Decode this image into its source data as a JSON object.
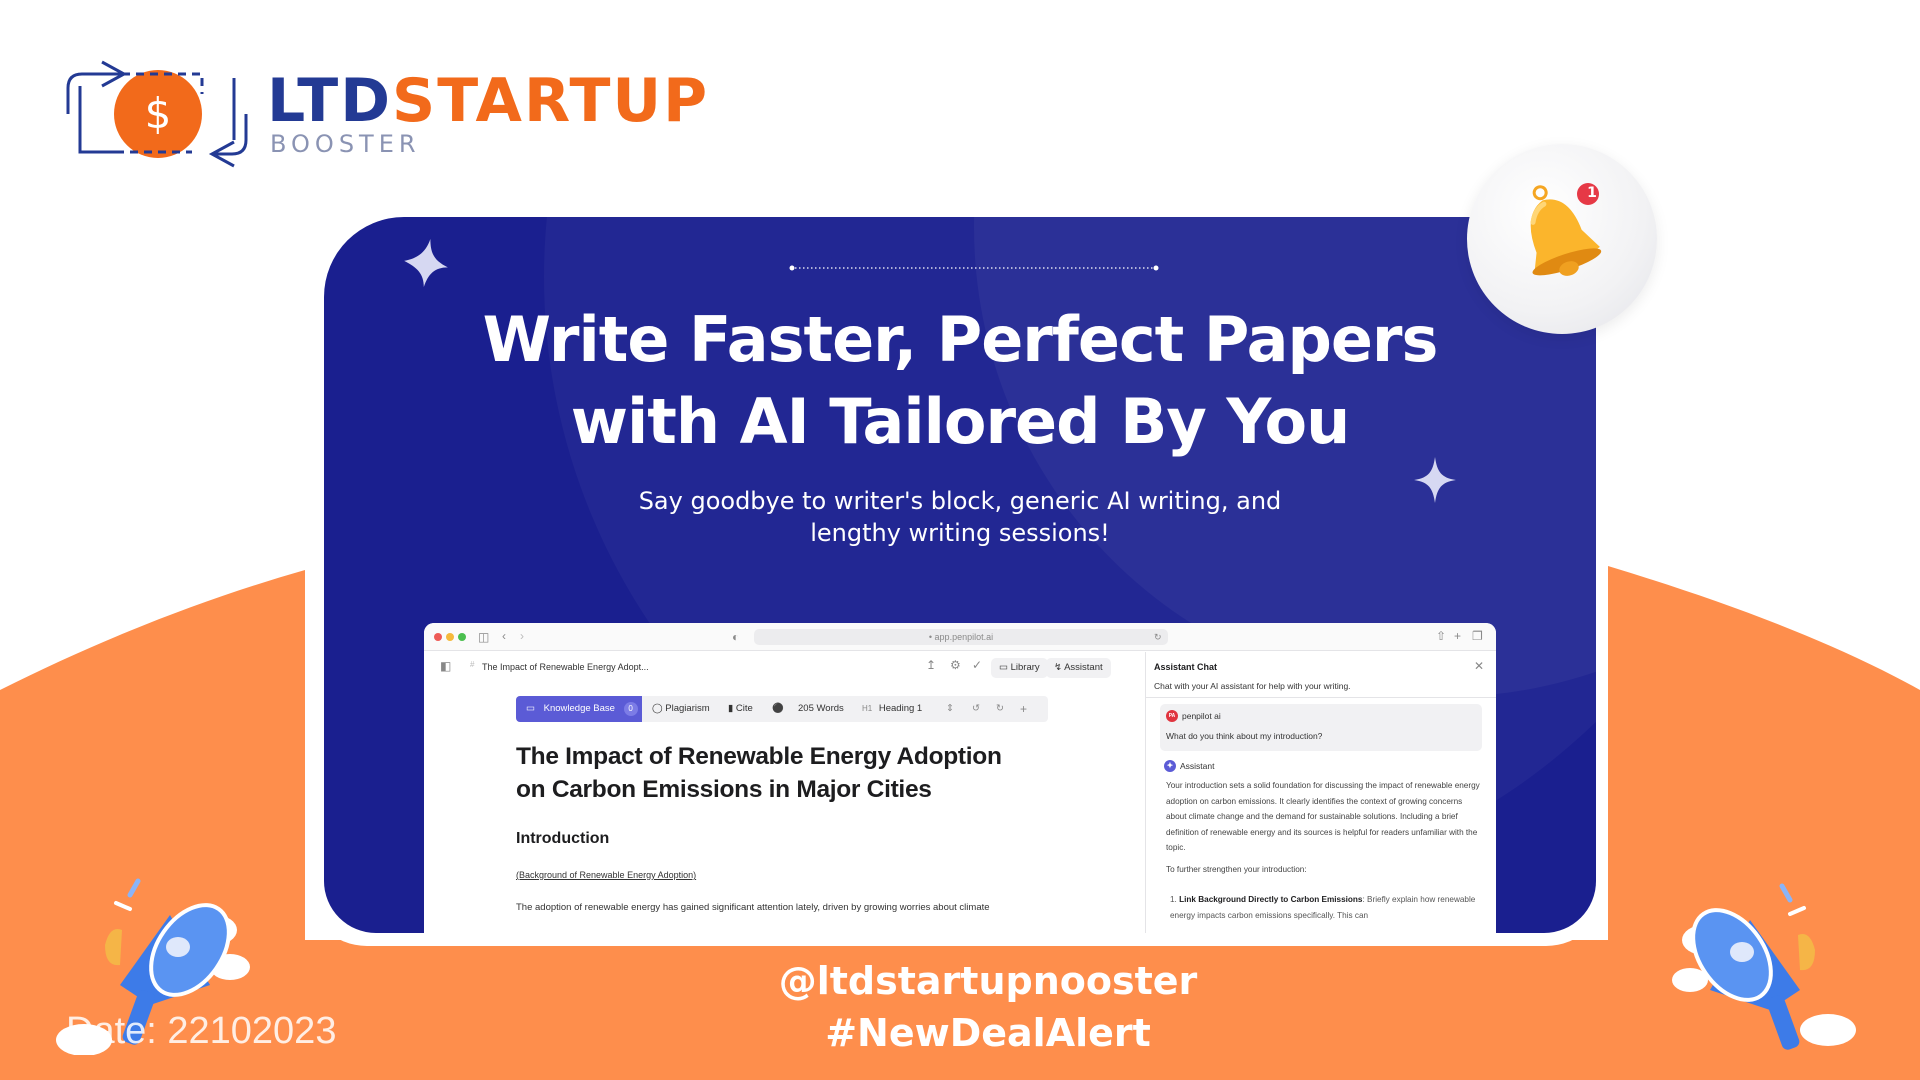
{
  "brand": {
    "name_part1": "LTD",
    "name_part2": "STARTUP",
    "tagline": "BOOSTER",
    "logo_icon": "dollar-exchange-icon",
    "colors": {
      "navy": "#233a94",
      "orange": "#f26a1b",
      "accent_orange_bg": "#fe8e4c",
      "card_blue": "#1a1f8f"
    }
  },
  "hero": {
    "headline_line1": "Write Faster, Perfect Papers",
    "headline_line2": "with AI Tailored By You",
    "subheadline": "Say goodbye to writer's block, generic AI writing, and lengthy writing sessions!"
  },
  "browser": {
    "url": "app.penpilot.ai",
    "nav_icons": [
      "sidebar-toggle-icon",
      "back-icon",
      "forward-icon",
      "shield-icon",
      "reload-icon",
      "share-icon",
      "new-tab-icon",
      "tabs-icon"
    ]
  },
  "editor": {
    "doc_breadcrumb": "The Impact of Renewable Energy Adopt...",
    "header_actions": {
      "library": "Library",
      "assistant": "Assistant"
    },
    "toolbar": {
      "knowledge_base": "Knowledge Base",
      "knowledge_base_count": "0",
      "plagiarism": "Plagiarism",
      "cite": "Cite",
      "word_count": "205 Words",
      "heading_tag": "H1",
      "heading_style": "Heading 1"
    },
    "document": {
      "title": "The Impact of Renewable Energy Adoption on Carbon Emissions in Major Cities",
      "section_heading": "Introduction",
      "section_link": "(Background of Renewable Energy Adoption)",
      "paragraph": "The adoption of renewable energy has gained significant attention lately, driven by growing worries about climate"
    }
  },
  "assistant_panel": {
    "title": "Assistant Chat",
    "subtitle": "Chat with your AI assistant for help with your writing.",
    "user_name": "penpilot ai",
    "user_avatar": "PA",
    "user_message": "What do you think about my introduction?",
    "assistant_name": "Assistant",
    "reply_paragraph": "Your introduction sets a solid foundation for discussing the impact of renewable energy adoption on carbon emissions. It clearly identifies the context of growing concerns about climate change and the demand for sustainable solutions. Including a brief definition of renewable energy and its sources is helpful for readers unfamiliar with the topic.",
    "reply_intro": "To further strengthen your introduction:",
    "reply_item_number": "1.",
    "reply_item_bold": "Link Background Directly to Carbon Emissions",
    "reply_item_text": ": Briefly explain how renewable energy impacts carbon emissions specifically. This can"
  },
  "notification": {
    "icon": "bell-icon",
    "badge_count": "1"
  },
  "footer": {
    "date": "Date: 22102023",
    "handle": "@ltdstartupnooster",
    "hashtag": "#NewDealAlert"
  }
}
